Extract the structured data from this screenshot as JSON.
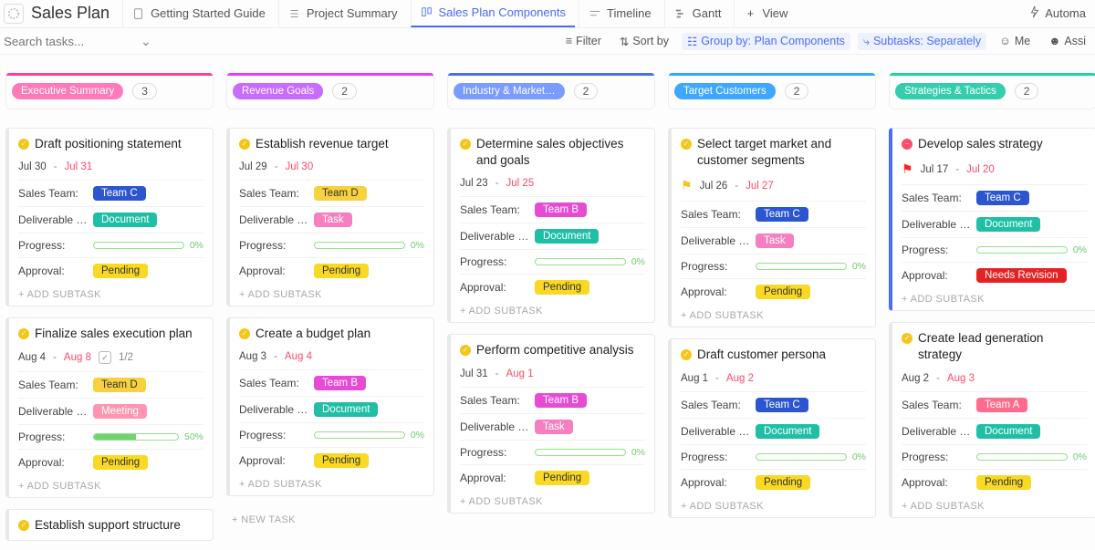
{
  "header": {
    "title": "Sales Plan",
    "tabs": [
      {
        "label": "Getting Started Guide"
      },
      {
        "label": "Project Summary"
      },
      {
        "label": "Sales Plan Components",
        "active": true
      },
      {
        "label": "Timeline"
      },
      {
        "label": "Gantt"
      },
      {
        "label": "View",
        "add": true
      }
    ],
    "automation_label": "Automa"
  },
  "filter": {
    "search_placeholder": "Search tasks...",
    "filter_label": "Filter",
    "sort_label": "Sort by",
    "group_label": "Group by: Plan Components",
    "subtasks_label": "Subtasks: Separately",
    "me_label": "Me",
    "assignee_label": "Assi"
  },
  "columns": [
    {
      "name": "Executive Summary",
      "count": "3",
      "pill_class": "pink",
      "cards": [
        {
          "title": "Draft positioning statement",
          "d1": "Jul 30",
          "d2": "Jul 31",
          "rows": {
            "team_label": "Sales Team:",
            "team": "Team C",
            "team_class": "team-c",
            "deliv_label": "Deliverable …",
            "deliv": "Document",
            "deliv_class": "document",
            "progress_label": "Progress:",
            "progress": 0,
            "approval_label": "Approval:",
            "approval": "Pending",
            "approval_class": "pending"
          },
          "add_subtask": "+ ADD SUBTASK"
        },
        {
          "title": "Finalize sales execution plan",
          "d1": "Aug 4",
          "d2": "Aug 8",
          "subtask_count": "1/2",
          "rows": {
            "team_label": "Sales Team:",
            "team": "Team D",
            "team_class": "team-d",
            "deliv_label": "Deliverable …",
            "deliv": "Meeting",
            "deliv_class": "meeting",
            "progress_label": "Progress:",
            "progress": 50,
            "approval_label": "Approval:",
            "approval": "Pending",
            "approval_class": "pending"
          },
          "add_subtask": "+ ADD SUBTASK"
        },
        {
          "title": "Establish support structure",
          "partial": true
        }
      ]
    },
    {
      "name": "Revenue Goals",
      "count": "2",
      "pill_class": "purple",
      "cards": [
        {
          "title": "Establish revenue target",
          "d1": "Jul 29",
          "d2": "Jul 30",
          "rows": {
            "team_label": "Sales Team:",
            "team": "Team D",
            "team_class": "team-d",
            "deliv_label": "Deliverable …",
            "deliv": "Task",
            "deliv_class": "task",
            "progress_label": "Progress:",
            "progress": 0,
            "approval_label": "Approval:",
            "approval": "Pending",
            "approval_class": "pending"
          },
          "add_subtask": "+ ADD SUBTASK"
        },
        {
          "title": "Create a budget plan",
          "d1": "Aug 3",
          "d2": "Aug 4",
          "rows": {
            "team_label": "Sales Team:",
            "team": "Team B",
            "team_class": "team-b",
            "deliv_label": "Deliverable …",
            "deliv": "Document",
            "deliv_class": "document",
            "progress_label": "Progress:",
            "progress": 0,
            "approval_label": "Approval:",
            "approval": "Pending",
            "approval_class": "pending"
          },
          "add_subtask": "+ ADD SUBTASK"
        }
      ],
      "new_task": "+ NEW TASK"
    },
    {
      "name": "Industry & Market…",
      "count": "2",
      "pill_class": "blue",
      "cards": [
        {
          "title": "Determine sales objectives and goals",
          "d1": "Jul 23",
          "d2": "Jul 25",
          "rows": {
            "team_label": "Sales Team:",
            "team": "Team B",
            "team_class": "team-b",
            "deliv_label": "Deliverable …",
            "deliv": "Document",
            "deliv_class": "document",
            "progress_label": "Progress:",
            "progress": 0,
            "approval_label": "Approval:",
            "approval": "Pending",
            "approval_class": "pending"
          },
          "add_subtask": "+ ADD SUBTASK"
        },
        {
          "title": "Perform competitive analysis",
          "d1": "Jul 31",
          "d2": "Aug 1",
          "rows": {
            "team_label": "Sales Team:",
            "team": "Team B",
            "team_class": "team-b",
            "deliv_label": "Deliverable …",
            "deliv": "Task",
            "deliv_class": "task",
            "progress_label": "Progress:",
            "progress": 0,
            "approval_label": "Approval:",
            "approval": "Pending",
            "approval_class": "pending"
          },
          "add_subtask": "+ ADD SUBTASK"
        }
      ]
    },
    {
      "name": "Target Customers",
      "count": "2",
      "pill_class": "cyan",
      "cards": [
        {
          "title": "Select target market and customer segments",
          "flag": "yellow",
          "d1": "Jul 26",
          "d2": "Jul 27",
          "rows": {
            "team_label": "Sales Team:",
            "team": "Team C",
            "team_class": "team-c",
            "deliv_label": "Deliverable …",
            "deliv": "Task",
            "deliv_class": "task",
            "progress_label": "Progress:",
            "progress": 0,
            "approval_label": "Approval:",
            "approval": "Pending",
            "approval_class": "pending"
          },
          "add_subtask": "+ ADD SUBTASK"
        },
        {
          "title": "Draft customer persona",
          "d1": "Aug 1",
          "d2": "Aug 2",
          "rows": {
            "team_label": "Sales Team:",
            "team": "Team C",
            "team_class": "team-c",
            "deliv_label": "Deliverable …",
            "deliv": "Document",
            "deliv_class": "document",
            "progress_label": "Progress:",
            "progress": 0,
            "approval_label": "Approval:",
            "approval": "Pending",
            "approval_class": "pending"
          },
          "add_subtask": "+ ADD SUBTASK"
        }
      ]
    },
    {
      "name": "Strategies & Tactics",
      "count": "2",
      "pill_class": "teal",
      "cards": [
        {
          "title": "Develop sales strategy",
          "status": "red",
          "flag": "red",
          "d1": "Jul 17",
          "d2": "Jul 20",
          "border": "left-blue",
          "rows": {
            "team_label": "Sales Team:",
            "team": "Team C",
            "team_class": "team-c",
            "deliv_label": "Deliverable …",
            "deliv": "Document",
            "deliv_class": "document",
            "progress_label": "Progress:",
            "progress": 0,
            "approval_label": "Approval:",
            "approval": "Needs Revision",
            "approval_class": "revision"
          },
          "add_subtask": "+ ADD SUBTASK"
        },
        {
          "title": "Create lead generation strategy",
          "d1": "Aug 2",
          "d2": "Aug 3",
          "rows": {
            "team_label": "Sales Team:",
            "team": "Team A",
            "team_class": "team-a",
            "deliv_label": "Deliverable …",
            "deliv": "Document",
            "deliv_class": "document",
            "progress_label": "Progress:",
            "progress": 0,
            "approval_label": "Approval:",
            "approval": "Pending",
            "approval_class": "pending"
          },
          "add_subtask": "+ ADD SUBTASK"
        }
      ]
    }
  ]
}
